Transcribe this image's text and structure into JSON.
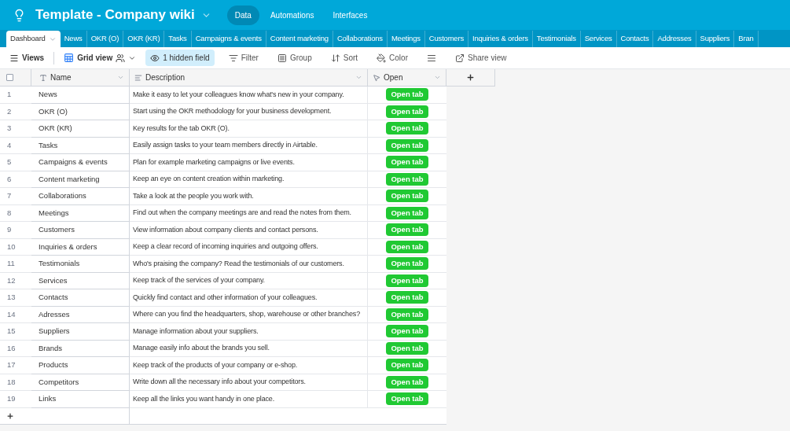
{
  "header": {
    "title": "Template - Company wiki",
    "nav": [
      {
        "label": "Data",
        "selected": true
      },
      {
        "label": "Automations",
        "selected": false
      },
      {
        "label": "Interfaces",
        "selected": false
      }
    ]
  },
  "tabs": [
    {
      "label": "Dashboard",
      "selected": true
    },
    {
      "label": "News",
      "selected": false
    },
    {
      "label": "OKR (O)",
      "selected": false
    },
    {
      "label": "OKR (KR)",
      "selected": false
    },
    {
      "label": "Tasks",
      "selected": false
    },
    {
      "label": "Campaigns & events",
      "selected": false
    },
    {
      "label": "Content marketing",
      "selected": false
    },
    {
      "label": "Collaborations",
      "selected": false
    },
    {
      "label": "Meetings",
      "selected": false
    },
    {
      "label": "Customers",
      "selected": false
    },
    {
      "label": "Inquiries & orders",
      "selected": false
    },
    {
      "label": "Testimonials",
      "selected": false
    },
    {
      "label": "Services",
      "selected": false
    },
    {
      "label": "Contacts",
      "selected": false
    },
    {
      "label": "Addresses",
      "selected": false
    },
    {
      "label": "Suppliers",
      "selected": false
    },
    {
      "label": "Bran",
      "selected": false
    }
  ],
  "toolbar": {
    "views": "Views",
    "grid_view": "Grid view",
    "items": [
      {
        "kind": "hidden",
        "label": "1 hidden field",
        "active": true
      },
      {
        "kind": "filter",
        "label": "Filter",
        "active": false
      },
      {
        "kind": "group",
        "label": "Group",
        "active": false
      },
      {
        "kind": "sort",
        "label": "Sort",
        "active": false
      },
      {
        "kind": "color",
        "label": "Color",
        "active": false
      },
      {
        "kind": "height",
        "active": false
      },
      {
        "kind": "share",
        "label": "Share view",
        "active": false
      }
    ]
  },
  "table": {
    "select_all": {
      "checked": false
    },
    "columns": [
      "Name",
      "Description",
      "Open"
    ],
    "rows": [
      {
        "index": "1",
        "name": "News",
        "description": "Make it easy to let your colleagues know what's new in your company.",
        "button": "Open tab"
      },
      {
        "index": "2",
        "name": "OKR (O)",
        "description": "Start using the OKR methodology for your business development.",
        "button": "Open tab"
      },
      {
        "index": "3",
        "name": "OKR (KR)",
        "description": "Key results for the tab OKR (O).",
        "button": "Open tab"
      },
      {
        "index": "4",
        "name": "Tasks",
        "description": "Easily assign tasks to your team members directly in Airtable.",
        "button": "Open tab"
      },
      {
        "index": "5",
        "name": "Campaigns & events",
        "description": "Plan for example marketing campaigns or live events.",
        "button": "Open tab"
      },
      {
        "index": "6",
        "name": "Content marketing",
        "description": "Keep an eye on content creation within marketing.",
        "button": "Open tab"
      },
      {
        "index": "7",
        "name": "Collaborations",
        "description": "Take a look at the people you work with.",
        "button": "Open tab"
      },
      {
        "index": "8",
        "name": "Meetings",
        "description": "Find out when the company meetings are and read the notes from them.",
        "button": "Open tab"
      },
      {
        "index": "9",
        "name": "Customers",
        "description": "View information about company clients and contact persons.",
        "button": "Open tab"
      },
      {
        "index": "10",
        "name": "Inquiries & orders",
        "description": "Keep a clear record of incoming inquiries and outgoing offers.",
        "button": "Open tab"
      },
      {
        "index": "11",
        "name": "Testimonials",
        "description": "Who's praising the company? Read the testimonials of our customers.",
        "button": "Open tab"
      },
      {
        "index": "12",
        "name": "Services",
        "description": "Keep track of the services of your company.",
        "button": "Open tab"
      },
      {
        "index": "13",
        "name": "Contacts",
        "description": "Quickly find contact and other information of your colleagues.",
        "button": "Open tab"
      },
      {
        "index": "14",
        "name": "Adresses",
        "description": "Where can you find the headquarters, shop, warehouse or other branches?",
        "button": "Open tab"
      },
      {
        "index": "15",
        "name": "Suppliers",
        "description": "Manage information about your suppliers.",
        "button": "Open tab"
      },
      {
        "index": "16",
        "name": "Brands",
        "description": "Manage easily info about the brands you sell.",
        "button": "Open tab"
      },
      {
        "index": "17",
        "name": "Products",
        "description": "Keep track of the products of your company or e-shop.",
        "button": "Open tab"
      },
      {
        "index": "18",
        "name": "Competitors",
        "description": "Write down all the necessary info about your competitors.",
        "button": "Open tab"
      },
      {
        "index": "19",
        "name": "Links",
        "description": "Keep all the links you want handy in one place.",
        "button": "Open tab"
      }
    ]
  }
}
